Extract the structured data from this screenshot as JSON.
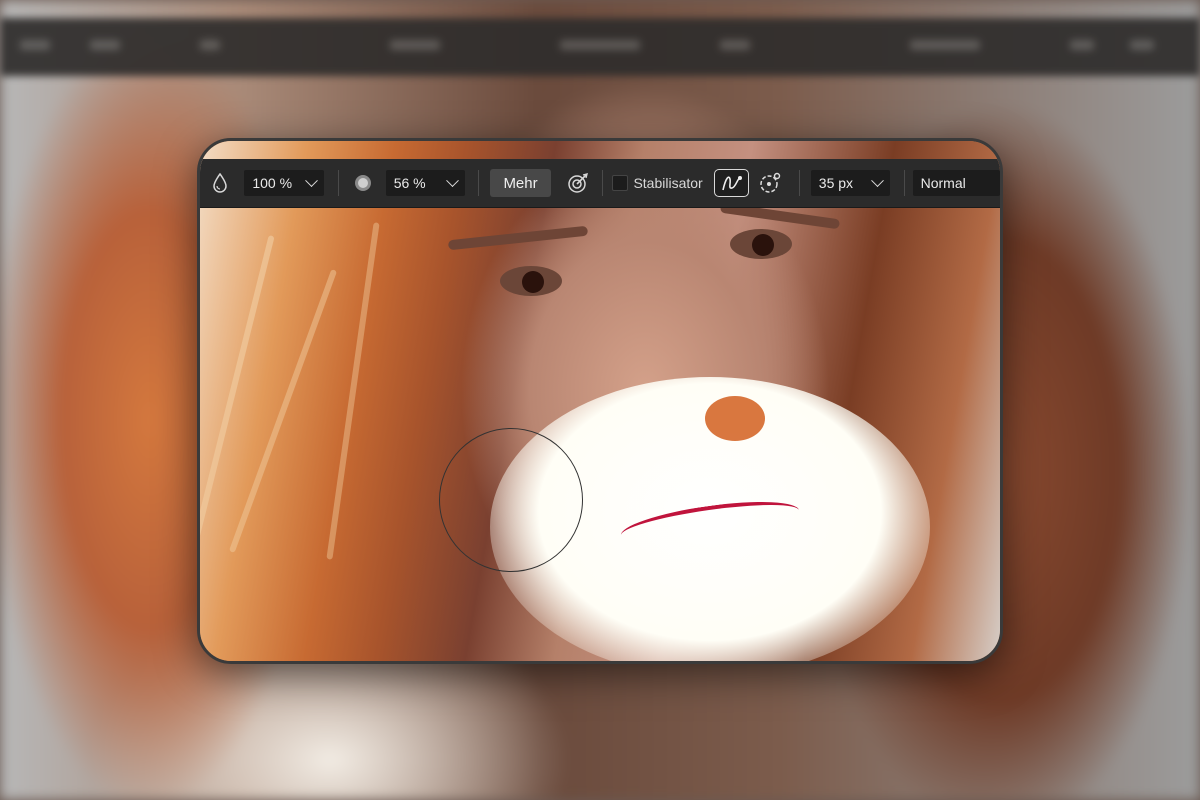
{
  "toolbar": {
    "flow_value": "100 %",
    "hardness_value": "56 %",
    "more_label": "Mehr",
    "stabilizer_label": "Stabilisator",
    "stabilizer_checked": false,
    "size_value": "35 px",
    "blend_mode_value": "Normal",
    "icons": {
      "flow": "water-drop-icon",
      "hardness": "hardness-circle-icon",
      "brush_options": "brush-target-icon",
      "rope_mode": "rope-stroke-icon",
      "window_mode": "lasso-circle-icon"
    }
  },
  "colors": {
    "toolbar_bg": "#2b2b2b",
    "field_bg": "#1c1c1c",
    "button_bg": "#484848",
    "text": "#e6e6e6"
  }
}
